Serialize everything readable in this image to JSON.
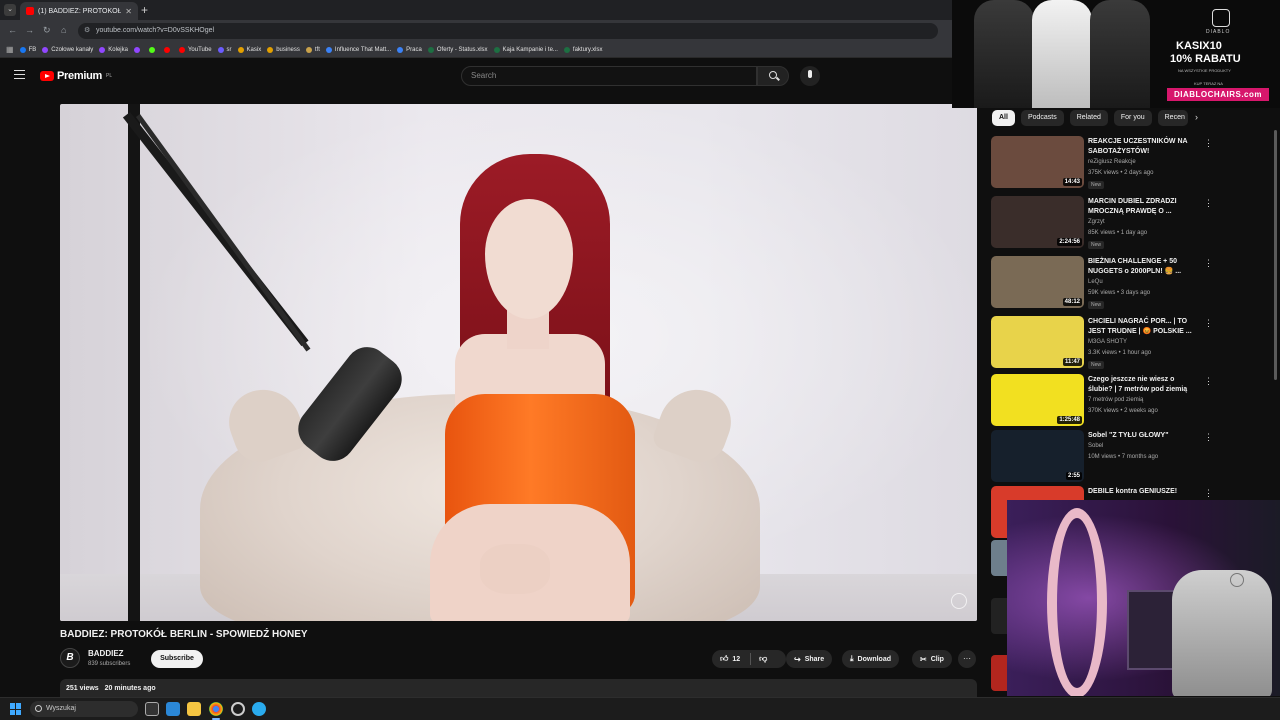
{
  "browser": {
    "tab_title": "(1) BADDIEZ: PROTOKÓŁ BE...",
    "tab_close": "✕",
    "new_tab": "+",
    "url": "youtube.com/watch?v=D0vSSKHOgel",
    "bookmarks": [
      {
        "label": "FB",
        "color": "#1877f2"
      },
      {
        "label": "Czołowe kanały",
        "color": "#9147ff"
      },
      {
        "label": "Kolejka",
        "color": "#9147ff"
      },
      {
        "label": "",
        "color": "#9147ff"
      },
      {
        "label": "",
        "color": "#53fc18"
      },
      {
        "label": "",
        "color": "#ff0000"
      },
      {
        "label": "YouTube",
        "color": "#ff0000"
      },
      {
        "label": "sr",
        "color": "#6b5cff"
      },
      {
        "label": "Kasix",
        "color": "#e3a000"
      },
      {
        "label": "business",
        "color": "#e3a000"
      },
      {
        "label": "tft",
        "color": "#c9a24b"
      },
      {
        "label": "Influence That Matt...",
        "color": "#3b82f6"
      },
      {
        "label": "Praca",
        "color": "#3b82f6"
      },
      {
        "label": "Oferty - Status.xlsx",
        "color": "#1d6f42"
      },
      {
        "label": "Kaja Kampanie i te...",
        "color": "#1d6f42"
      },
      {
        "label": "faktury.xlsx",
        "color": "#1d6f42"
      }
    ]
  },
  "youtube": {
    "logo_text": "Premium",
    "logo_region": "PL",
    "search_placeholder": "Search",
    "video": {
      "title": "BADDIEZ: PROTOKÓŁ BERLIN - SPOWIEDŹ HONEY",
      "channel": "BADDIEZ",
      "channel_initial": "B",
      "subscribers": "839 subscribers",
      "subscribe_label": "Subscribe",
      "likes": "12",
      "share_label": "Share",
      "download_label": "Download",
      "clip_label": "Clip",
      "more_label": "···",
      "views": "251 views",
      "uploaded": "20 minutes ago"
    },
    "chips": [
      "All",
      "Podcasts",
      "Related",
      "For you",
      "Recen"
    ],
    "recommendations": [
      {
        "title": "REAKCJE UCZESTNIKÓW NA SABOTAŻYSTÓW!",
        "channel": "reZigiusz Reakcje",
        "meta": "375K views • 2 days ago",
        "badge": "New",
        "duration": "14:43",
        "thumb": "#6b4b3e"
      },
      {
        "title": "MARCIN DUBIEL ZDRADZI MROCZNĄ PRAWDĘ O ...",
        "channel": "Zgrzyt",
        "meta": "85K views • 1 day ago",
        "badge": "New",
        "duration": "2:24:56",
        "thumb": "#3a2d2a"
      },
      {
        "title": "BIEŻNIA CHALLENGE + 50 NUGGETS o 2000PLN! 🍔 ...",
        "channel": "LeQu",
        "meta": "59K views • 3 days ago",
        "badge": "New",
        "duration": "48:12",
        "thumb": "#7a6a55"
      },
      {
        "title": "CHCIELI NAGRAĆ POR... | TO JEST TRUDNE | 😡 POLSKIE ...",
        "channel": "M3GA SHOTY",
        "meta": "3.3K views • 1 hour ago",
        "badge": "New",
        "duration": "11:47",
        "thumb": "#e8d34a"
      },
      {
        "title": "Czego jeszcze nie wiesz o ślubie? | 7 metrów pod ziemią",
        "channel": "7 metrów pod ziemią",
        "meta": "370K views • 2 weeks ago",
        "badge": "",
        "duration": "1:25:48",
        "thumb": "#f2e020"
      },
      {
        "title": "Sobel \"Z TYŁU GŁOWY\"",
        "channel": "Sobel",
        "meta": "10M views • 7 months ago",
        "badge": "",
        "duration": "2:55",
        "thumb": "#16202c"
      },
      {
        "title": "DEBILE kontra GENIUSZE!",
        "channel": "",
        "meta": "",
        "badge": "",
        "duration": "",
        "thumb": "#d83b2a"
      }
    ]
  },
  "ad": {
    "brand": "DIABLO",
    "line1": "KASIX10",
    "line2": "10% RABATU",
    "small1": "NA WSZYSTKIE PRODUKTY",
    "small2": "KUP TERAZ NA",
    "cta": "DIABLOCHAIRS.com"
  },
  "taskbar": {
    "search_placeholder": "Wyszukaj"
  }
}
